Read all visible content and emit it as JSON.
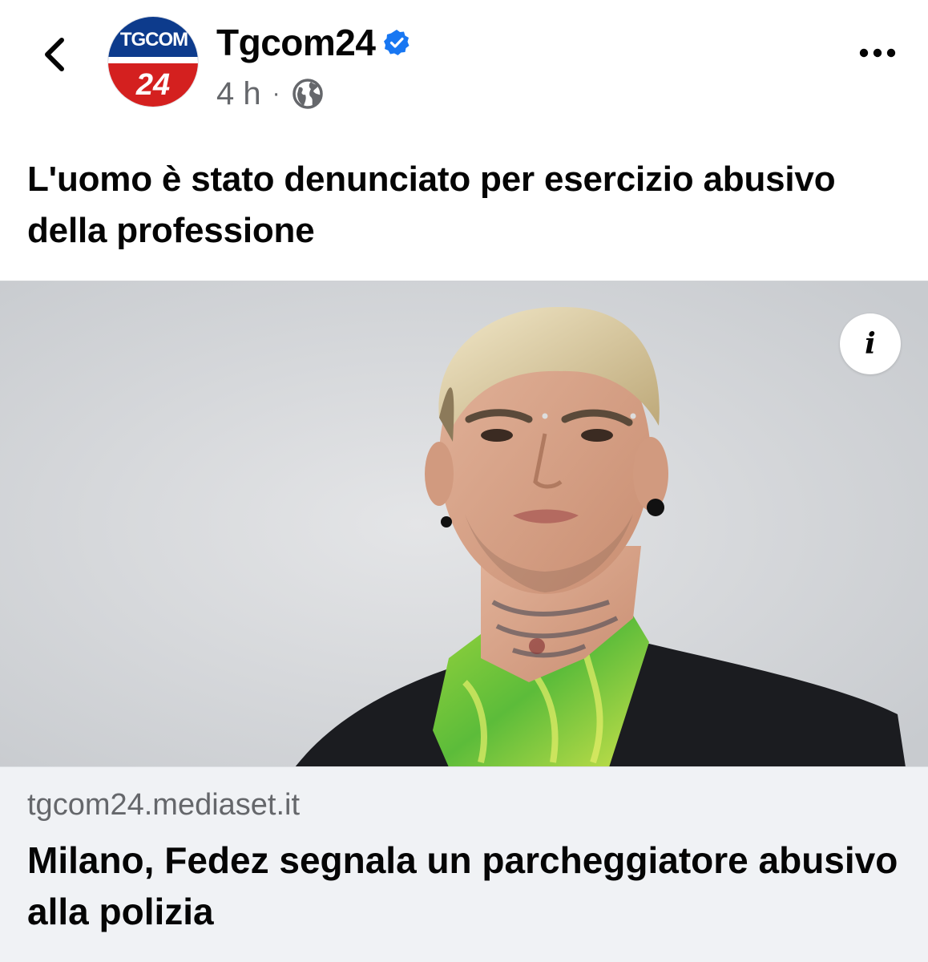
{
  "post": {
    "page_name": "Tgcom24",
    "avatar_text_top": "TGCOM",
    "avatar_text_bottom": "24",
    "time": "4 h",
    "separator": "·",
    "caption": "L'uomo è stato denunciato per esercizio abusivo della professione"
  },
  "link_card": {
    "domain": "tgcom24.mediaset.it",
    "headline": "Milano, Fedez segnala un parcheggiatore abusivo alla polizia",
    "info_label": "i"
  },
  "colors": {
    "verified_blue": "#1877f2",
    "secondary_text": "#65676b",
    "footer_bg": "#f0f2f5",
    "logo_blue": "#0d3b8c",
    "logo_red": "#d4201f"
  },
  "icons": {
    "back": "chevron-left-icon",
    "verified": "verified-badge-icon",
    "privacy": "globe-icon",
    "more": "more-horizontal-icon",
    "info": "info-icon"
  }
}
